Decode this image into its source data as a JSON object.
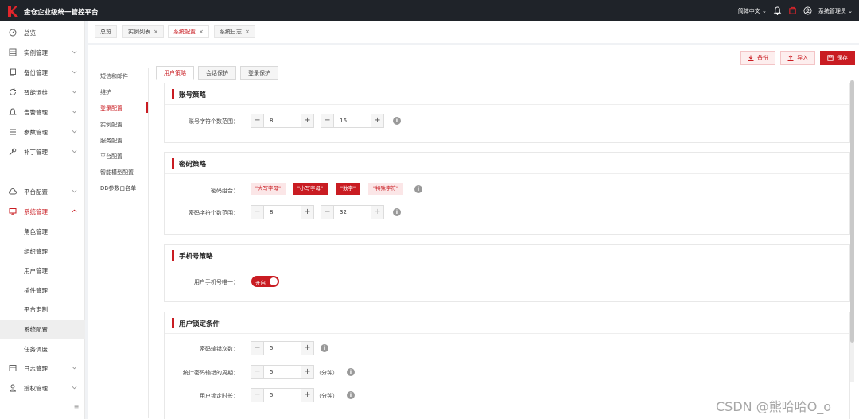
{
  "topbar": {
    "title": "金仓企业级统一管控平台",
    "language": "简体中文",
    "user": "系统管理员"
  },
  "sidebar": {
    "items": [
      {
        "label": "总览",
        "icon": "dashboard-icon"
      },
      {
        "label": "实例管理",
        "icon": "database-icon"
      },
      {
        "label": "备份管理",
        "icon": "copy-icon"
      },
      {
        "label": "智能运维",
        "icon": "refresh-icon"
      },
      {
        "label": "告警管理",
        "icon": "bell-icon"
      },
      {
        "label": "参数管理",
        "icon": "list-icon"
      },
      {
        "label": "补丁管理",
        "icon": "wrench-icon"
      },
      {
        "label": "平台配置",
        "icon": "cloud-icon"
      },
      {
        "label": "系统管理",
        "icon": "monitor-icon"
      }
    ],
    "sub_items": [
      "角色管理",
      "组织管理",
      "用户管理",
      "插件管理",
      "平台定制",
      "系统配置",
      "任务调度"
    ],
    "bottom_items": [
      {
        "label": "日志管理",
        "icon": "log-icon"
      },
      {
        "label": "授权管理",
        "icon": "user-key-icon"
      }
    ],
    "collapse_icon": "≡"
  },
  "tabs": [
    {
      "label": "总览",
      "closable": false
    },
    {
      "label": "实例列表",
      "closable": true
    },
    {
      "label": "系统配置",
      "closable": true,
      "active": true
    },
    {
      "label": "系统日志",
      "closable": true
    }
  ],
  "actions": {
    "backup": "备份",
    "import": "导入",
    "save": "保存"
  },
  "subnav": [
    "短信和邮件",
    "维护",
    "登录配置",
    "实例配置",
    "服务配置",
    "平台配置",
    "智能模型配置",
    "DB参数白名单"
  ],
  "subtabs": [
    "用户策略",
    "会话保护",
    "登录保护"
  ],
  "sections": {
    "account": {
      "title": "账号策略",
      "range_label": "账号字符个数范围：",
      "min": "8",
      "max": "16"
    },
    "password": {
      "title": "密码策略",
      "combo_label": "密码组合：",
      "combos": [
        {
          "label": "\"大写字母\"",
          "selected": false
        },
        {
          "label": "\"小写字母\"",
          "selected": true
        },
        {
          "label": "\"数字\"",
          "selected": true
        },
        {
          "label": "\"特殊字符\"",
          "selected": false
        }
      ],
      "range_label": "密码字符个数范围：",
      "min": "8",
      "max": "32"
    },
    "phone": {
      "title": "手机号策略",
      "unique_label": "用户手机号唯一：",
      "toggle_text": "开启",
      "toggle_on": true
    },
    "lock": {
      "title": "用户锁定条件",
      "attempts_label": "密码输错次数：",
      "attempts": "5",
      "period_label": "统计密码输错的周期：",
      "period": "5",
      "period_unit": "（分钟）",
      "duration_label": "用户锁定时长：",
      "duration": "5",
      "duration_unit": "（分钟）"
    }
  },
  "watermark": "CSDN @熊哈哈O_o",
  "colors": {
    "accent": "#c91c22",
    "topbar": "#1f2329"
  }
}
